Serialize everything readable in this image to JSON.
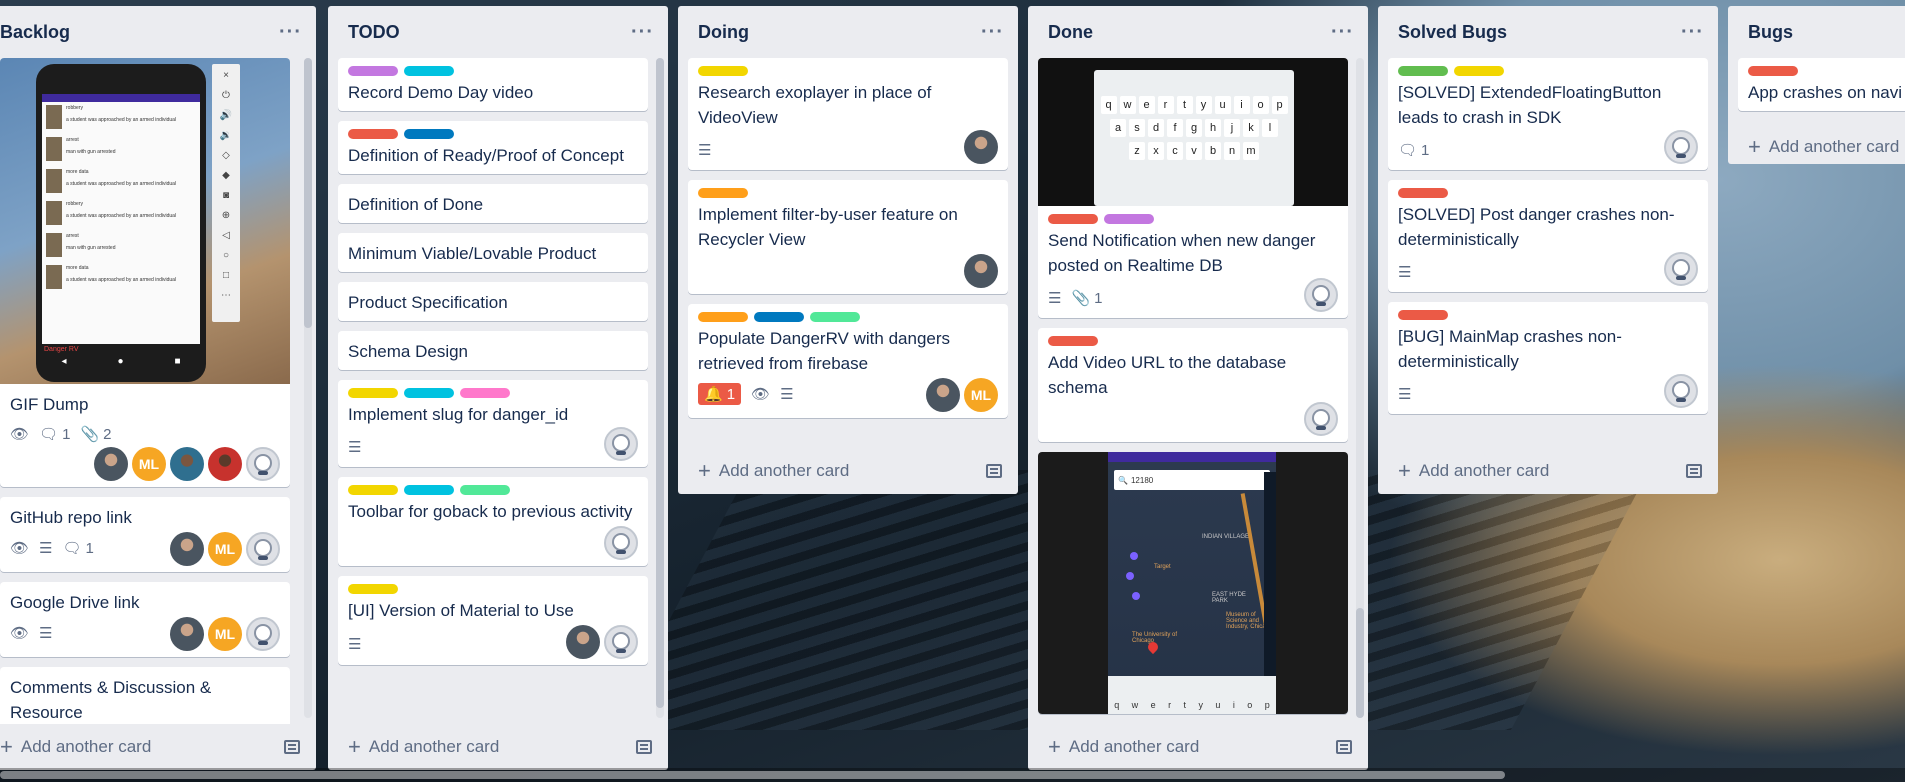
{
  "board": {
    "add_card_label": "Add another card",
    "lists": [
      {
        "title": "Backlog",
        "cards": [
          {
            "title": "GIF Dump",
            "comments": "1",
            "attachments": "2"
          },
          {
            "title": "GitHub repo link",
            "comments": "1"
          },
          {
            "title": "Google Drive link"
          },
          {
            "title": "Comments & Discussion & Resource"
          }
        ],
        "phone_screen": {
          "items": [
            "robbery",
            "arrest",
            "more data",
            "robbery",
            "arrest",
            "more data"
          ],
          "sub_a": "a student was approached by an armed individual",
          "sub_b": "man with gun arrested",
          "footer": "Danger RV"
        }
      },
      {
        "title": "TODO",
        "cards": [
          {
            "title": "Record Demo Day video"
          },
          {
            "title": "Definition of Ready/Proof of Concept"
          },
          {
            "title": "Definition of Done"
          },
          {
            "title": "Minimum Viable/Lovable Product"
          },
          {
            "title": "Product Specification"
          },
          {
            "title": "Schema Design"
          },
          {
            "title": "Implement slug for danger_id"
          },
          {
            "title": "Toolbar for goback to previous activity"
          },
          {
            "title": "[UI] Version of Material to Use"
          }
        ]
      },
      {
        "title": "Doing",
        "cards": [
          {
            "title": "Research exoplayer in place of VideoView"
          },
          {
            "title": "Implement filter-by-user feature on Recycler View"
          },
          {
            "title": "Populate DangerRV with dangers retrieved from firebase",
            "alerts": "1"
          }
        ]
      },
      {
        "title": "Done",
        "cards": [
          {
            "title": "Send Notification when new danger posted on Realtime DB",
            "attachments": "1"
          },
          {
            "title": "Add Video URL to the database schema"
          }
        ],
        "keyboard_rows": [
          [
            "q",
            "w",
            "e",
            "r",
            "t",
            "y",
            "u",
            "i",
            "o",
            "p"
          ],
          [
            "a",
            "s",
            "d",
            "f",
            "g",
            "h",
            "j",
            "k",
            "l"
          ],
          [
            "z",
            "x",
            "c",
            "v",
            "b",
            "n",
            "m"
          ]
        ],
        "map_search_value": "12180",
        "map_places": [
          "INDIAN VILLAGE",
          "EAST HYDE PARK",
          "Museum of Science and Industry, Chicago",
          "Target",
          "The University of Chicago"
        ]
      },
      {
        "title": "Solved Bugs",
        "cards": [
          {
            "title": "[SOLVED] ExtendedFloatingButton leads to crash in SDK",
            "comments": "1"
          },
          {
            "title": "[SOLVED] Post danger crashes non-deterministically"
          },
          {
            "title": "[BUG] MainMap crashes non-deterministically"
          }
        ]
      },
      {
        "title": "Bugs",
        "cards": [
          {
            "title": "App crashes on navi"
          }
        ]
      }
    ],
    "avatar_initials": "ML",
    "menu_glyph": "···"
  },
  "colors": {
    "label_green": "#61bd4f",
    "label_yellow": "#f2d600",
    "label_orange": "#ff9f1a",
    "label_red": "#eb5a46",
    "label_purple": "#c377e0",
    "label_blue": "#0079bf",
    "label_sky": "#00c2e0",
    "label_lime": "#51e898",
    "label_pink": "#ff78cb"
  }
}
